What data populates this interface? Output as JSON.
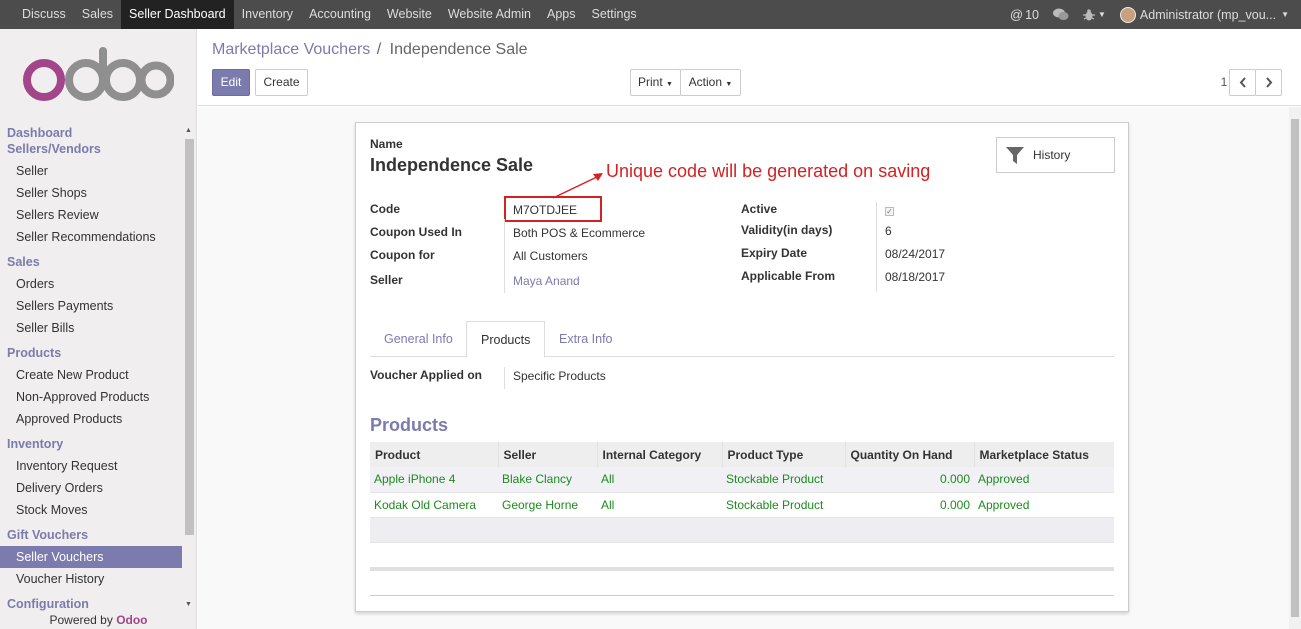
{
  "topbar": {
    "menu": [
      "Discuss",
      "Sales",
      "Seller Dashboard",
      "Inventory",
      "Accounting",
      "Website",
      "Website Admin",
      "Apps",
      "Settings"
    ],
    "active_menu": "Seller Dashboard",
    "notification_count": "10",
    "user": "Administrator (mp_vou..."
  },
  "sidebar": {
    "groups": [
      {
        "title": "Dashboard",
        "items": []
      },
      {
        "title": "Sellers/Vendors",
        "items": [
          "Seller",
          "Seller Shops",
          "Sellers Review",
          "Seller Recommendations"
        ]
      },
      {
        "title": "Sales",
        "items": [
          "Orders",
          "Sellers Payments",
          "Seller Bills"
        ]
      },
      {
        "title": "Products",
        "items": [
          "Create New Product",
          "Non-Approved Products",
          "Approved Products"
        ]
      },
      {
        "title": "Inventory",
        "items": [
          "Inventory Request",
          "Delivery Orders",
          "Stock Moves"
        ]
      },
      {
        "title": "Gift Vouchers",
        "items": [
          "Seller Vouchers",
          "Voucher History"
        ]
      },
      {
        "title": "Configuration",
        "items": []
      }
    ],
    "selected": "Seller Vouchers",
    "powered_by": "Powered by",
    "powered_brand": "Odoo"
  },
  "control": {
    "breadcrumb_parent": "Marketplace Vouchers",
    "breadcrumb_sep": "/",
    "breadcrumb_current": "Independence Sale",
    "edit_label": "Edit",
    "create_label": "Create",
    "print_label": "Print",
    "action_label": "Action",
    "pager": "1 / 1"
  },
  "form": {
    "name_label": "Name",
    "name_value": "Independence Sale",
    "history_label": "History",
    "annotation": "Unique code will be generated on saving",
    "left_fields": [
      {
        "label": "Code",
        "value": "M7OTDJEE"
      },
      {
        "label": "Coupon Used In",
        "value": "Both POS & Ecommerce"
      },
      {
        "label": "Coupon for",
        "value": "All Customers"
      },
      {
        "label": "Seller",
        "value": "Maya Anand"
      }
    ],
    "right_fields": [
      {
        "label": "Active",
        "value": ""
      },
      {
        "label": "Validity(in days)",
        "value": "6"
      },
      {
        "label": "Expiry Date",
        "value": "08/24/2017"
      },
      {
        "label": "Applicable From",
        "value": "08/18/2017"
      }
    ],
    "tabs": [
      "General Info",
      "Products",
      "Extra Info"
    ],
    "active_tab": "Products",
    "voucher_applied_label": "Voucher Applied on",
    "voucher_applied_value": "Specific Products",
    "products_title": "Products",
    "columns": [
      "Product",
      "Seller",
      "Internal Category",
      "Product Type",
      "Quantity On Hand",
      "Marketplace Status"
    ],
    "rows": [
      [
        "Apple iPhone 4",
        "Blake Clancy",
        "All",
        "Stockable Product",
        "0.000",
        "Approved"
      ],
      [
        "Kodak Old Camera",
        "George Horne",
        "All",
        "Stockable Product",
        "0.000",
        "Approved"
      ]
    ]
  },
  "colors": {
    "accent": "#7c7bad",
    "annotation": "#d42222",
    "row_text": "#1f8a1f"
  }
}
